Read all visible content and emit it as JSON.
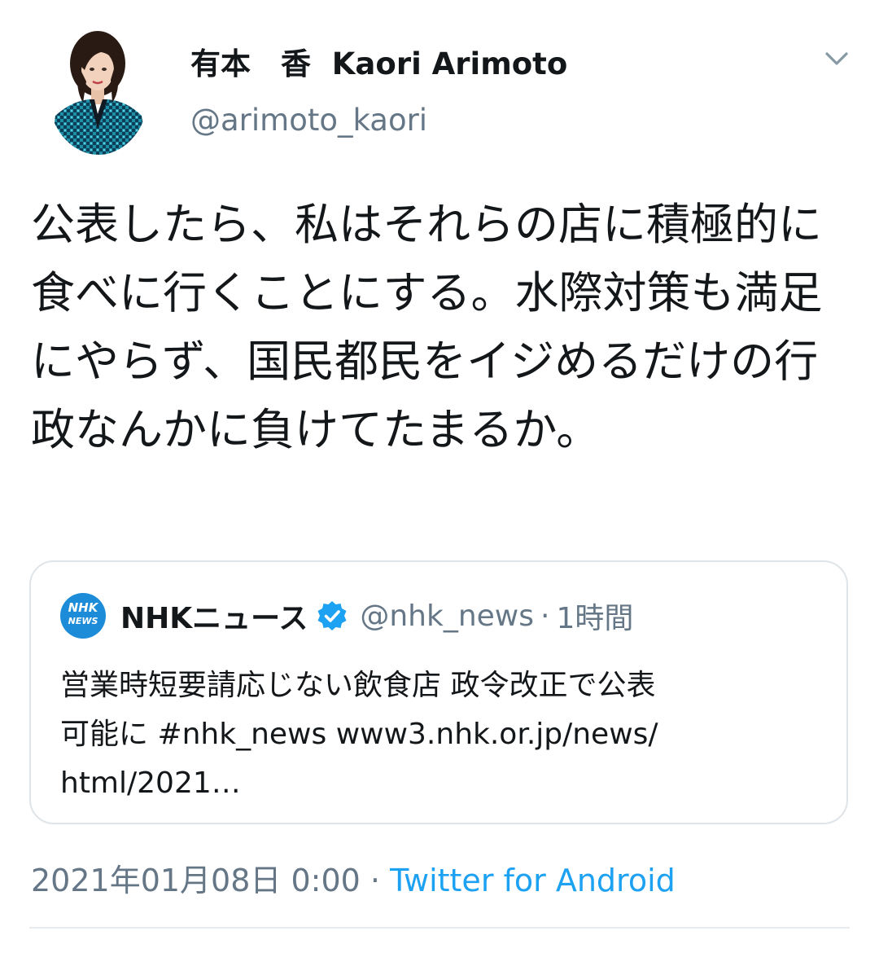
{
  "author": {
    "display_name": "有本　香  Kaori Arimoto",
    "handle": "@arimoto_kaori"
  },
  "tweet": {
    "text": "公表したら、私はそれらの店に積極的に食べに行くことにする。水際対策も満足にやらず、国民都民をイジめるだけの行政なんかに負けてたまるか。"
  },
  "quote": {
    "logo_top": "NHK",
    "logo_bottom": "NEWS",
    "name": "NHKニュース",
    "handle": "@nhk_news",
    "separator": "·",
    "time": "1時間",
    "text": "営業時短要請応じない飲食店 政令改正で公表\n可能に #nhk_news www3.nhk.or.jp/news/\nhtml/2021…"
  },
  "meta": {
    "timestamp": "2021年01月08日 0:00",
    "separator": " · ",
    "source": "Twitter for Android"
  },
  "icons": {
    "caret": "chevron-down-icon",
    "verified": "verified-badge-icon"
  },
  "colors": {
    "accent": "#1da1f2",
    "secondary_text": "#657786",
    "nhk_blue": "#1d8cd8"
  }
}
